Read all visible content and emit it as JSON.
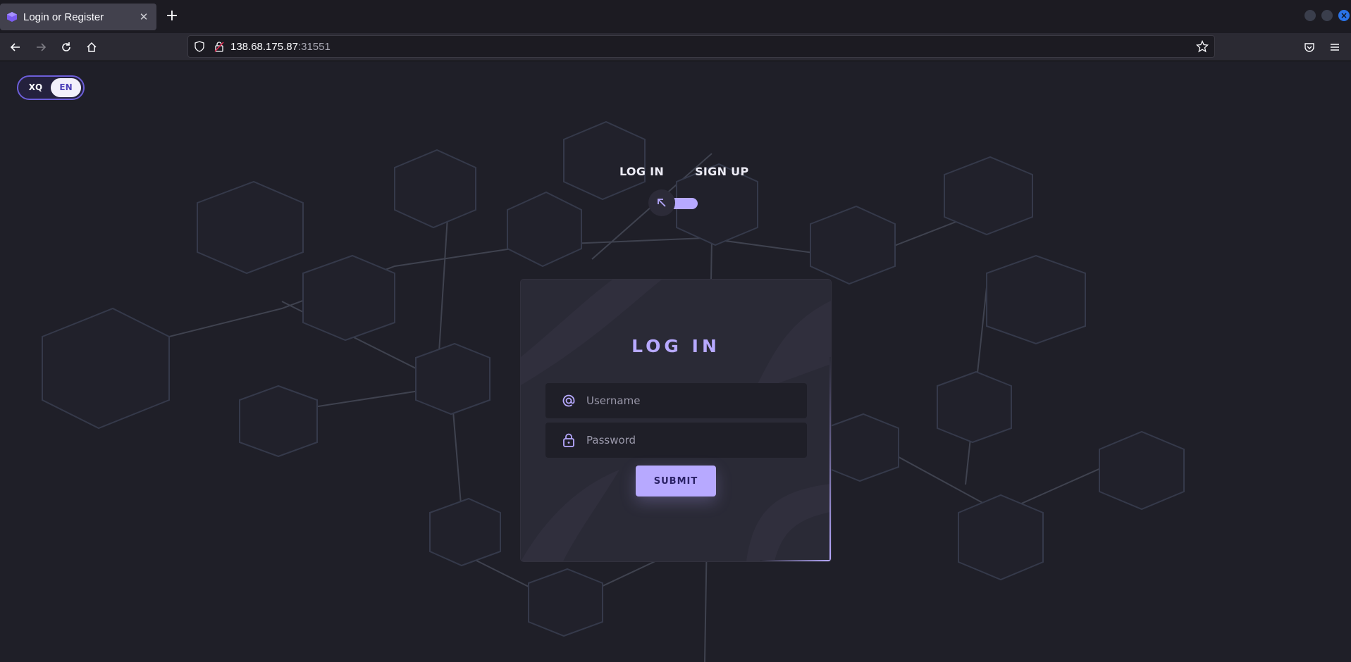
{
  "browser": {
    "tab_title": "Login or Register",
    "url_host": "138.68.175.87",
    "url_port": ":31551"
  },
  "language_toggle": {
    "options": [
      "XQ",
      "EN"
    ],
    "selected": "EN"
  },
  "mode": {
    "login_label": "LOG IN",
    "signup_label": "SIGN UP"
  },
  "form": {
    "title": "LOG IN",
    "username_placeholder": "Username",
    "password_placeholder": "Password",
    "submit_label": "SUBMIT"
  },
  "colors": {
    "accent": "#b7a9ff",
    "background": "#1f1f28",
    "card": "#2a2a36"
  }
}
